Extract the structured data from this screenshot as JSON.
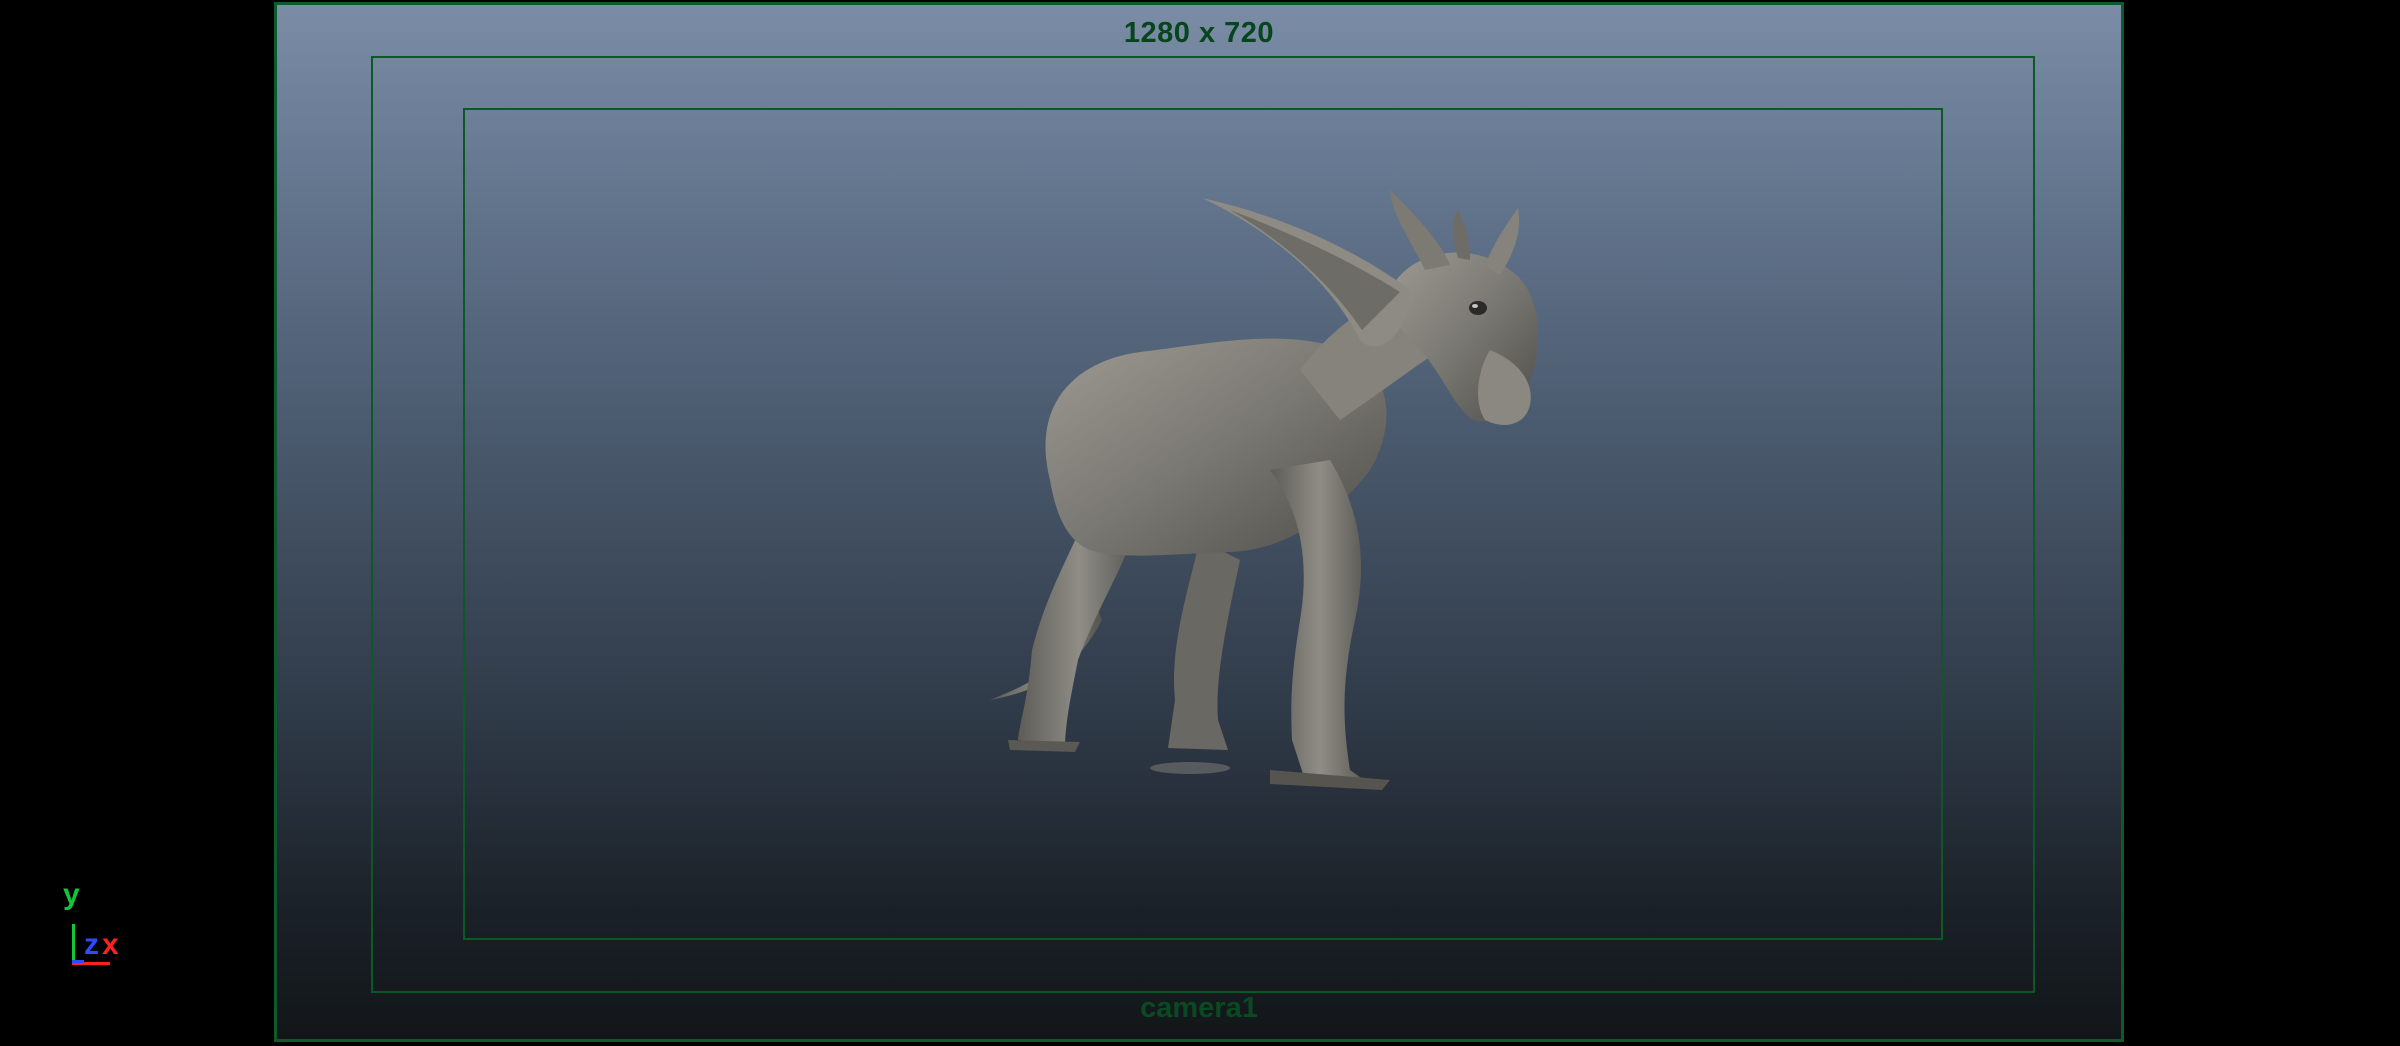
{
  "viewport": {
    "resolution_label": "1280 x 720",
    "camera_label": "camera1"
  },
  "axis": {
    "y": "y",
    "z": "z",
    "x": "x"
  },
  "colors": {
    "gate_border": "#0e5a2c",
    "label_green": "#07451d",
    "axis_y": "#12c53a",
    "axis_z": "#2a4dff",
    "axis_x": "#ff2020",
    "creature_fill": "#7e7c76"
  },
  "scene": {
    "object": "creature-model"
  }
}
